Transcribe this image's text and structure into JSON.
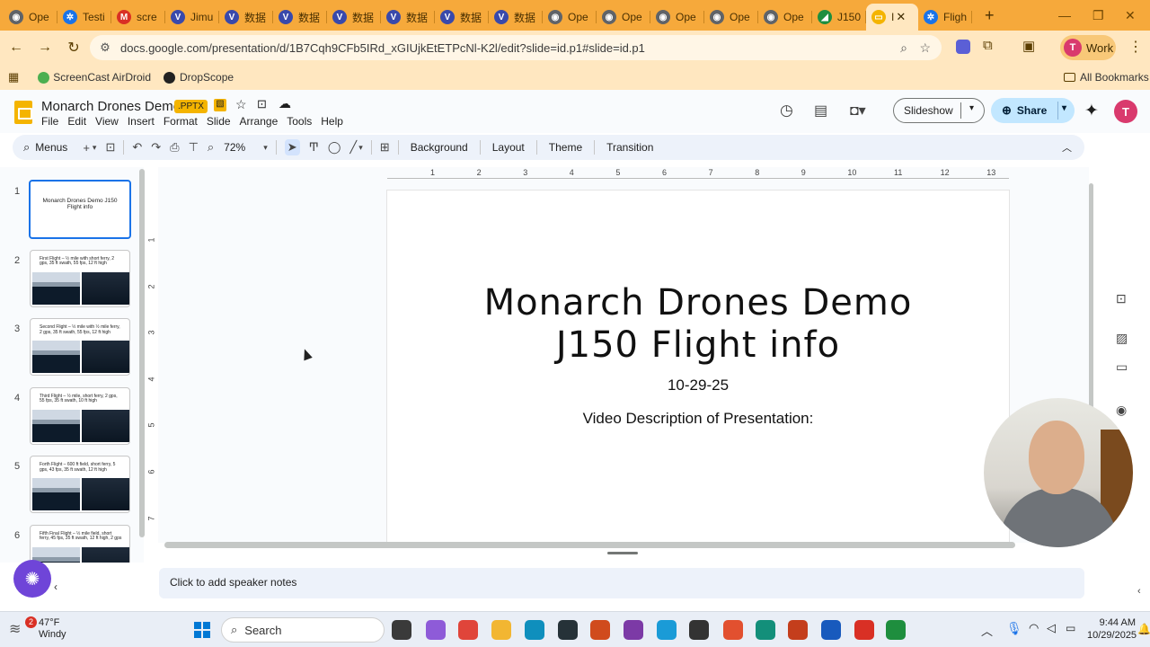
{
  "browser": {
    "tabs": [
      {
        "label": "Ope",
        "fav_color": "#5f6368",
        "fav_glyph": "◉"
      },
      {
        "label": "Testi",
        "fav_color": "#1a73e8",
        "fav_glyph": "✲"
      },
      {
        "label": "scre",
        "fav_color": "#d93025",
        "fav_glyph": "M"
      },
      {
        "label": "Jimu",
        "fav_color": "#3949ab",
        "fav_glyph": "V"
      },
      {
        "label": "数据",
        "fav_color": "#3949ab",
        "fav_glyph": "V"
      },
      {
        "label": "数据",
        "fav_color": "#3949ab",
        "fav_glyph": "V"
      },
      {
        "label": "数据",
        "fav_color": "#3949ab",
        "fav_glyph": "V"
      },
      {
        "label": "数据",
        "fav_color": "#3949ab",
        "fav_glyph": "V"
      },
      {
        "label": "数据",
        "fav_color": "#3949ab",
        "fav_glyph": "V"
      },
      {
        "label": "数据",
        "fav_color": "#3949ab",
        "fav_glyph": "V"
      },
      {
        "label": "Ope",
        "fav_color": "#5f6368",
        "fav_glyph": "◉"
      },
      {
        "label": "Ope",
        "fav_color": "#5f6368",
        "fav_glyph": "◉"
      },
      {
        "label": "Ope",
        "fav_color": "#5f6368",
        "fav_glyph": "◉"
      },
      {
        "label": "Ope",
        "fav_color": "#5f6368",
        "fav_glyph": "◉"
      },
      {
        "label": "Ope",
        "fav_color": "#5f6368",
        "fav_glyph": "◉"
      },
      {
        "label": "J150",
        "fav_color": "#1e8e3e",
        "fav_glyph": "◢"
      },
      {
        "label": "I",
        "fav_color": "#f4b400",
        "fav_glyph": "▭",
        "active": true
      },
      {
        "label": "Fligh",
        "fav_color": "#1a73e8",
        "fav_glyph": "✲"
      }
    ],
    "new_tab": "+",
    "url": "docs.google.com/presentation/d/1B7Cqh9CFb5IRd_xGIUjkEtETPcNl-K2l/edit?slide=id.p1#slide=id.p1",
    "profile_label": "Work",
    "profile_initial": "T",
    "bookmarks": [
      {
        "label": "ScreenCast AirDroid",
        "icon": "screencast-icon"
      },
      {
        "label": "DropScope",
        "icon": "dropscope-icon"
      }
    ],
    "all_bookmarks": "All Bookmarks"
  },
  "app": {
    "title": "Monarch Drones Demo",
    "badge": ".PPTX",
    "menus": [
      "File",
      "Edit",
      "View",
      "Insert",
      "Format",
      "Slide",
      "Arrange",
      "Tools",
      "Help"
    ],
    "slideshow_label": "Slideshow",
    "share_label": "Share",
    "user_initial": "T"
  },
  "toolbar": {
    "menus_label": "Menus",
    "zoom": "72%",
    "background": "Background",
    "layout": "Layout",
    "theme": "Theme",
    "transition": "Transition"
  },
  "filmstrip": [
    {
      "num": "1",
      "text": "Monarch Drones Demo J150 Flight info",
      "selected": true
    },
    {
      "num": "2",
      "text": "First Flight – ½ mile with short ferry, 2 gps, 35 ft swath, 55 fps, 12 ft high"
    },
    {
      "num": "3",
      "text": "Second Flight – ½ mile with ½ mile ferry, 2 gps, 35 ft swath, 55 fps, 12 ft high"
    },
    {
      "num": "4",
      "text": "Third Flight – ½ mile, short ferry, 2 gps, 55 fps, 35 ft swath, 10 ft high"
    },
    {
      "num": "5",
      "text": "Forth Flight – 600 ft field, short ferry, 5 gps, 43 fps, 35 ft swath, 12 ft high"
    },
    {
      "num": "6",
      "text": "Fifth Final Flight – ½ mile field, short ferry, 45 fps, 35 ft swath, 12 ft high, 2 gps"
    }
  ],
  "ruler_h": [
    "1",
    "2",
    "3",
    "4",
    "5",
    "6",
    "7",
    "8",
    "9",
    "10",
    "11",
    "12",
    "13"
  ],
  "ruler_v": [
    "1",
    "2",
    "3",
    "4",
    "5",
    "6",
    "7"
  ],
  "slide": {
    "title_line1": "Monarch Drones Demo",
    "title_line2": "J150 Flight info",
    "date": "10-29-25",
    "description": "Video Description of Presentation:"
  },
  "notes_placeholder": "Click to add speaker notes",
  "taskbar": {
    "weather_badge": "2",
    "temperature": "47°F",
    "condition": "Windy",
    "search": "Search",
    "time": "9:44 AM",
    "date": "10/29/2025"
  }
}
